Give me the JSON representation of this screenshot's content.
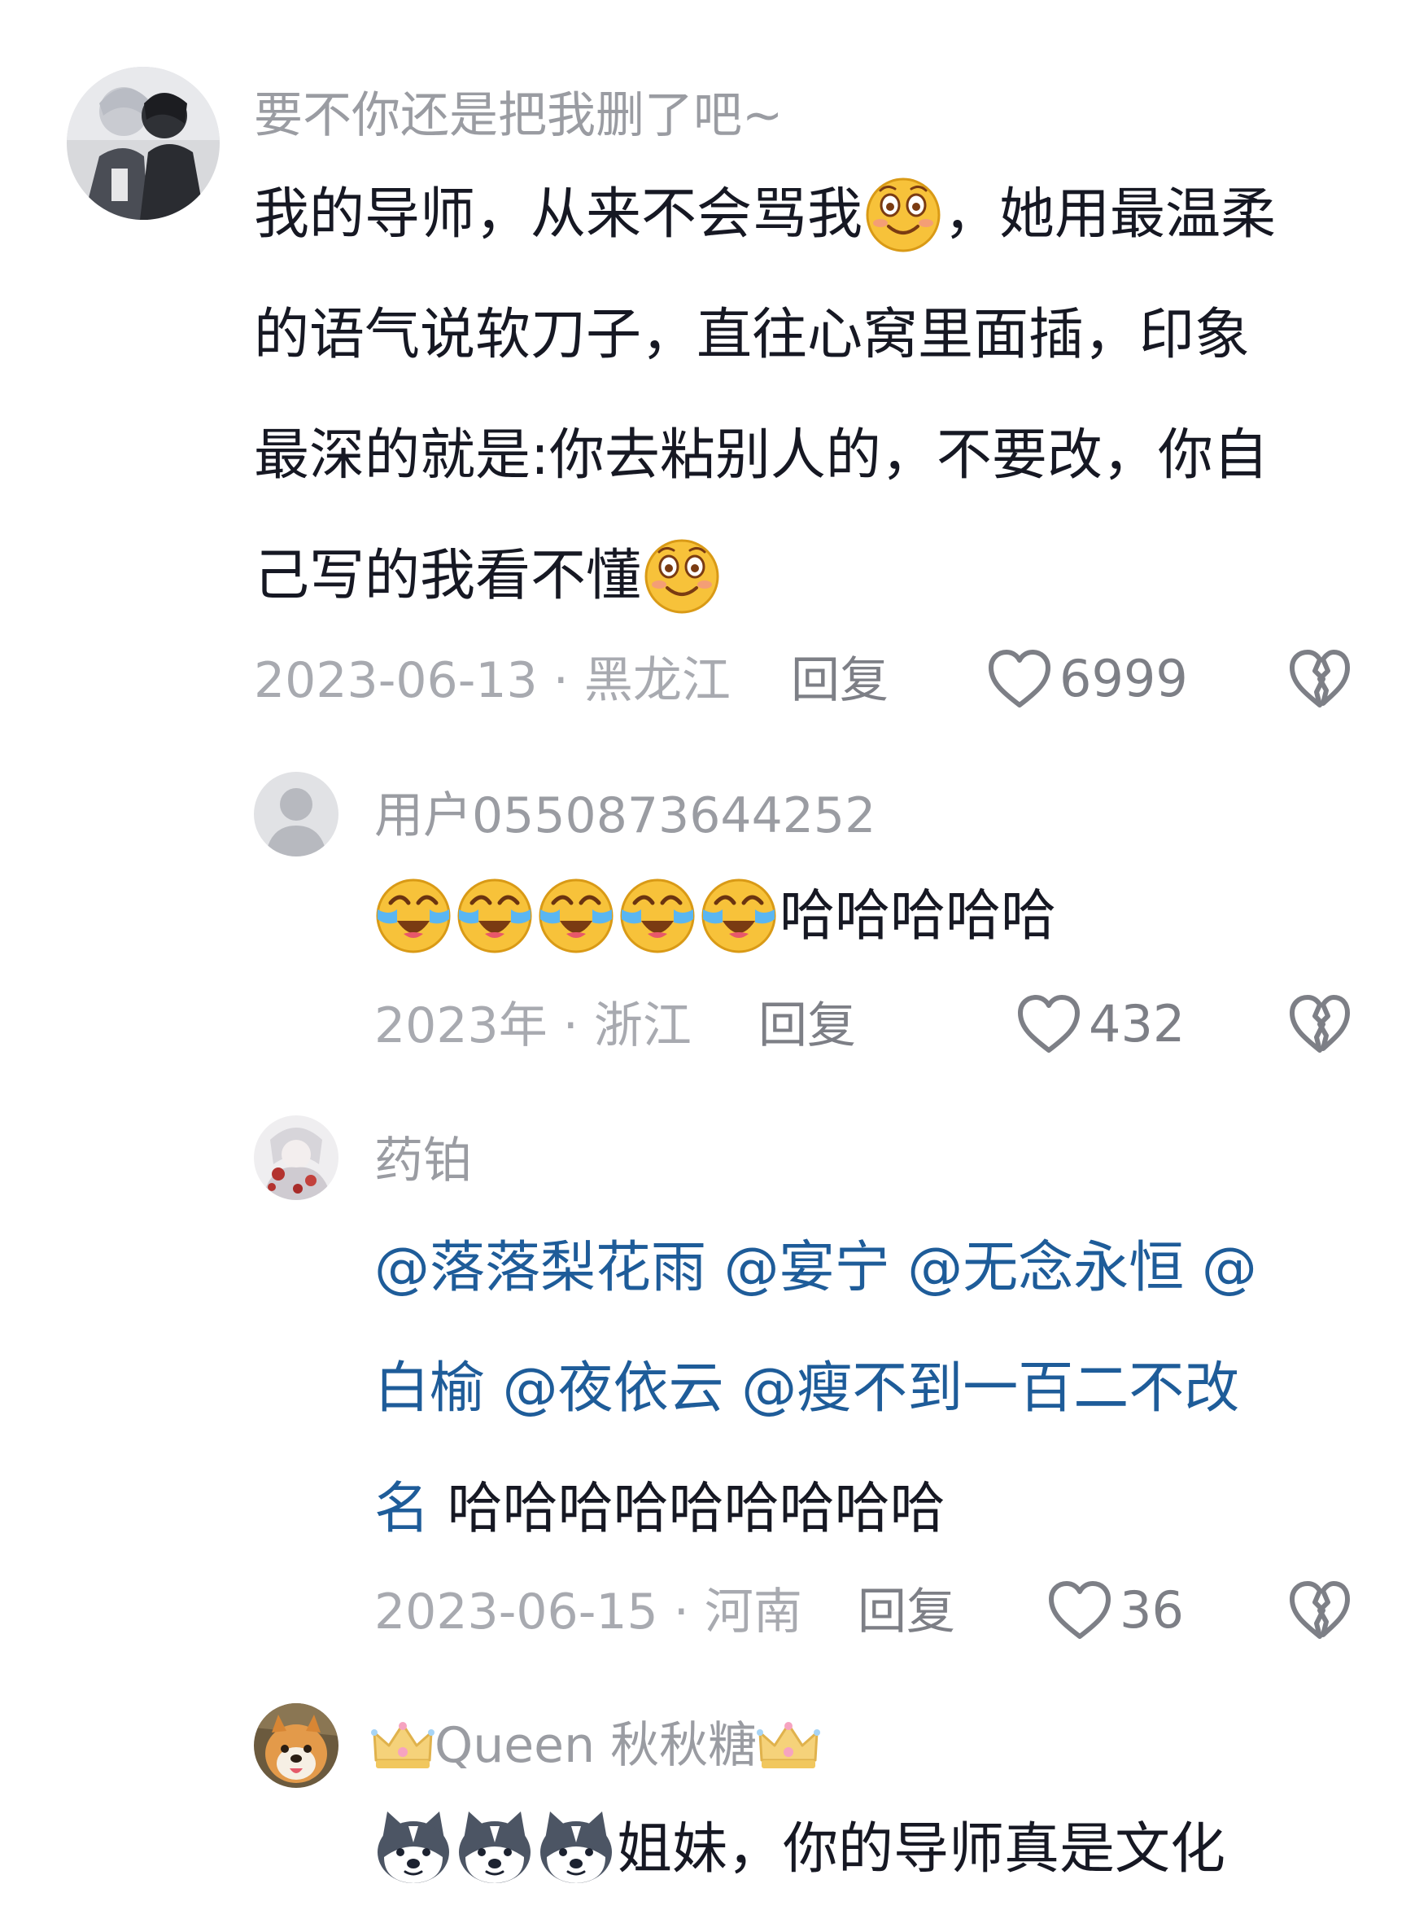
{
  "comments": [
    {
      "username": "要不你还是把我删了吧~",
      "lines": [
        {
          "parts": [
            "我的导师，从来不会骂我",
            "，她用最温柔"
          ]
        },
        {
          "text": "的语气说软刀子，直往心窝里面插，印象"
        },
        {
          "text": "最深的就是:你去粘别人的，不要改，你自"
        },
        {
          "text": "己写的我看不懂"
        }
      ],
      "meta": "2023-06-13 · 黑龙江",
      "reply": "回复",
      "likes": "6999"
    },
    {
      "username": "用户0550873644252",
      "text": "哈哈哈哈哈",
      "meta": "2023年 · 浙江",
      "reply": "回复",
      "likes": "432"
    },
    {
      "username": "药铂",
      "mentions_line1": "@落落梨花雨 @宴宁 @无念永恒 @",
      "mentions_line2": "白榆 @夜依云 @瘦不到一百二不改",
      "mentions_line3": "名",
      "trailing": " 哈哈哈哈哈哈哈哈哈",
      "meta": "2023-06-15 · 河南",
      "reply": "回复",
      "likes": "36"
    },
    {
      "username": "Queen 秋秋糖",
      "text": "姐妹，你的导师真是文化"
    }
  ],
  "icons": {
    "like": "heart-outline-icon",
    "dislike": "broken-heart-icon",
    "emoji_smile": "smile-emoji",
    "emoji_cry_laugh": "crying-laughing-emoji",
    "emoji_dog": "husky-dog-emoji",
    "crown": "crown-icon"
  },
  "colors": {
    "text": "#161823",
    "muted": "#a8aab0",
    "mention": "#1e5c99"
  }
}
